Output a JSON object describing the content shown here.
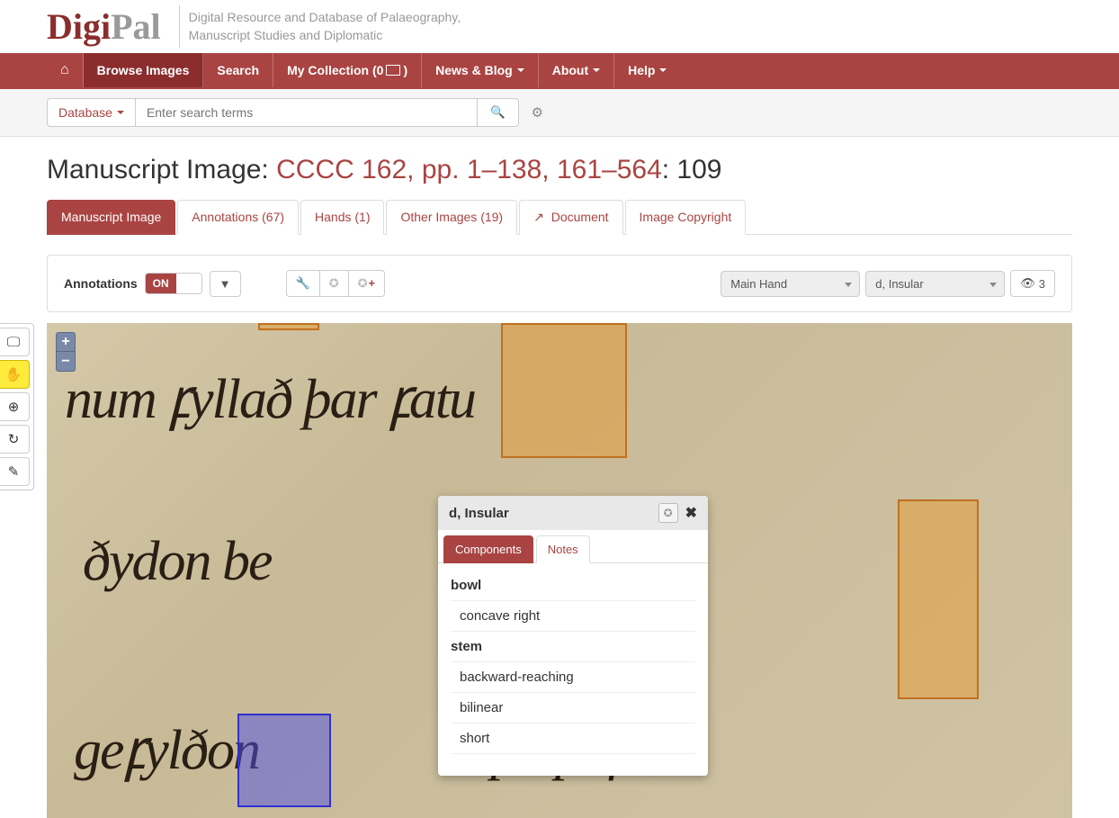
{
  "header": {
    "logo_a": "Digi",
    "logo_b": "Pal",
    "tagline_1": "Digital Resource and Database of Palaeography,",
    "tagline_2": "Manuscript Studies and Diplomatic"
  },
  "nav": {
    "browse": "Browse Images",
    "search": "Search",
    "collection_pre": "My Collection (0 ",
    "collection_post": " )",
    "news": "News & Blog ",
    "about": "About ",
    "help": "Help "
  },
  "searchbar": {
    "database": "Database ",
    "placeholder": "Enter search terms"
  },
  "title": {
    "prefix": "Manuscript Image: ",
    "link": "CCCC 162, pp. 1–138, 161–564",
    "suffix": ": 109"
  },
  "tabs": {
    "t0": "Manuscript Image",
    "t1": "Annotations (67)",
    "t2": "Hands (1)",
    "t3": "Other Images (19)",
    "t4": " Document",
    "t5": "Image Copyright"
  },
  "toolbar": {
    "annotations_label": "Annotations",
    "toggle": "ON",
    "hand_select": "Main Hand",
    "letter_select": "d, Insular",
    "count": "3"
  },
  "zoom": {
    "in": "+",
    "out": "−"
  },
  "popup": {
    "title": "d, Insular",
    "tab_components": "Components",
    "tab_notes": "Notes",
    "groups": [
      {
        "name": "bowl",
        "items": [
          "concave right"
        ]
      },
      {
        "name": "stem",
        "items": [
          "backward-reaching",
          "bilinear",
          "short"
        ]
      }
    ]
  }
}
